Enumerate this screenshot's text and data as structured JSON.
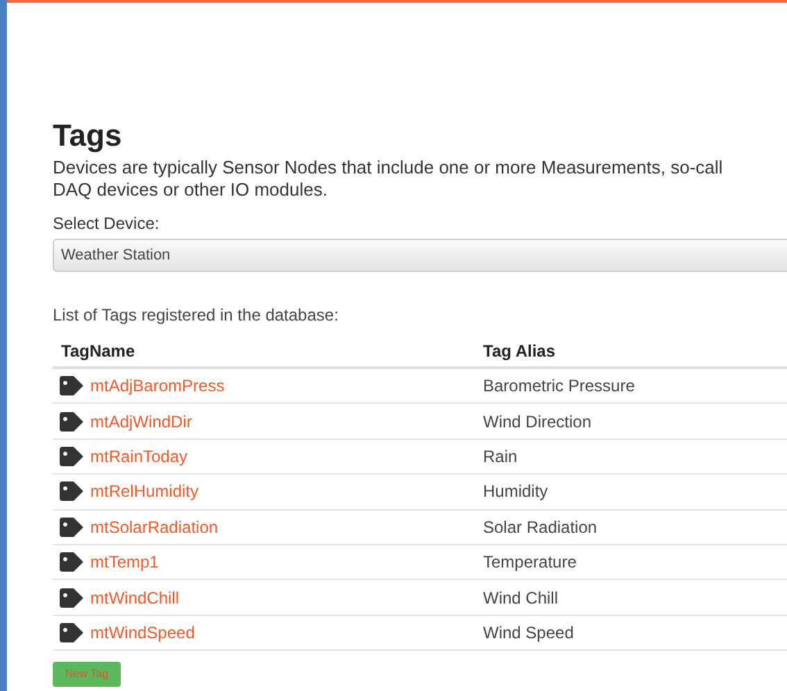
{
  "title": "Tags",
  "description_lines": [
    "Devices are typically Sensor Nodes that include one or more Measurements, so-call",
    "DAQ devices or other IO modules."
  ],
  "device_select": {
    "label": "Select Device:",
    "value": "Weather Station"
  },
  "list_caption": "List of Tags registered in the database:",
  "table": {
    "columns": [
      "TagName",
      "Tag Alias"
    ],
    "rows": [
      {
        "name": "mtAdjBaromPress",
        "alias": "Barometric Pressure"
      },
      {
        "name": "mtAdjWindDir",
        "alias": "Wind Direction"
      },
      {
        "name": "mtRainToday",
        "alias": "Rain"
      },
      {
        "name": "mtRelHumidity",
        "alias": "Humidity"
      },
      {
        "name": "mtSolarRadiation",
        "alias": "Solar Radiation"
      },
      {
        "name": "mtTemp1",
        "alias": "Temperature"
      },
      {
        "name": "mtWindChill",
        "alias": "Wind Chill"
      },
      {
        "name": "mtWindSpeed",
        "alias": "Wind Speed"
      }
    ]
  },
  "new_button": "New Tag"
}
